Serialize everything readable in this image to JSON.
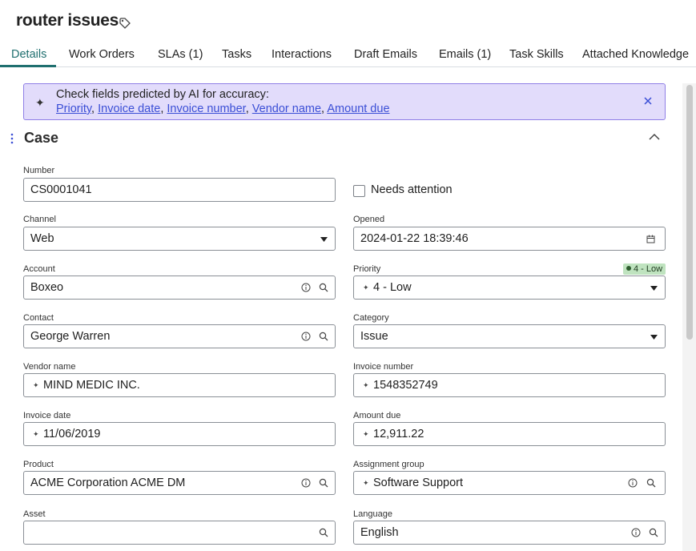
{
  "header": {
    "title": "router issues",
    "tag_icon": "tag-icon"
  },
  "tabs": [
    {
      "label": "Details",
      "active": true
    },
    {
      "label": "Work Orders"
    },
    {
      "label": "SLAs (1)"
    },
    {
      "label": "Tasks"
    },
    {
      "label": "Interactions"
    },
    {
      "label": "Draft Emails"
    },
    {
      "label": "Emails (1)"
    },
    {
      "label": "Task Skills"
    },
    {
      "label": "Attached Knowledge"
    }
  ],
  "banner": {
    "message": "Check fields predicted by AI for accuracy:",
    "links": [
      "Priority",
      "Invoice date",
      "Invoice number",
      "Vendor name",
      "Amount due"
    ],
    "separator": ", ",
    "color": "#e2dcfb"
  },
  "section": {
    "title": "Case"
  },
  "fields": {
    "number": {
      "label": "Number",
      "value": "CS0001041"
    },
    "needs_attention": {
      "label": "Needs attention",
      "checked": false
    },
    "channel": {
      "label": "Channel",
      "value": "Web"
    },
    "opened": {
      "label": "Opened",
      "value": "2024-01-22 18:39:46"
    },
    "account": {
      "label": "Account",
      "value": "Boxeo"
    },
    "priority": {
      "label": "Priority",
      "value": "4 - Low",
      "badge": "4 - Low"
    },
    "contact": {
      "label": "Contact",
      "value": "George Warren"
    },
    "category": {
      "label": "Category",
      "value": "Issue"
    },
    "vendor_name": {
      "label": "Vendor name",
      "value": "MIND MEDIC INC."
    },
    "invoice_number": {
      "label": "Invoice number",
      "value": "1548352749"
    },
    "invoice_date": {
      "label": "Invoice date",
      "value": "11/06/2019"
    },
    "amount_due": {
      "label": "Amount due",
      "value": "12,911.22"
    },
    "product": {
      "label": "Product",
      "value": "ACME Corporation ACME DM"
    },
    "assignment_group": {
      "label": "Assignment group",
      "value": "Software Support"
    },
    "asset": {
      "label": "Asset",
      "value": ""
    },
    "language": {
      "label": "Language",
      "value": "English"
    }
  },
  "colors": {
    "accent": "#1f6f6f",
    "link": "#3b4fd6",
    "badge": "#bfe3bf"
  }
}
